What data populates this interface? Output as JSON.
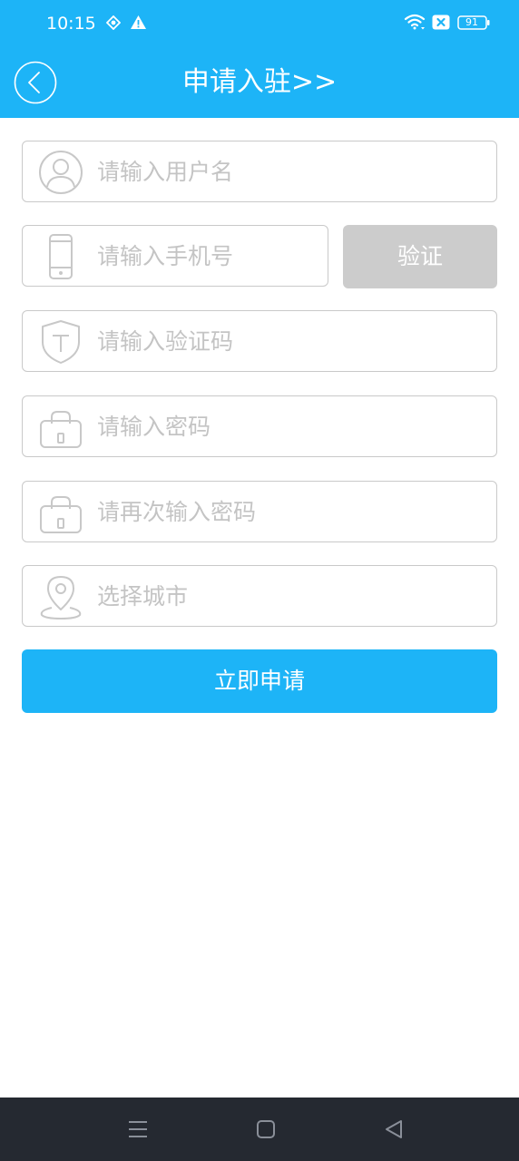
{
  "status_bar": {
    "time": "10:15",
    "battery": "91",
    "icons": [
      "location-icon",
      "alert-icon",
      "wifi-icon",
      "sim-off-icon",
      "battery-icon"
    ]
  },
  "header": {
    "title": "申请入驻>>",
    "back_icon": "chevron-left-icon"
  },
  "form": {
    "username": {
      "placeholder": "请输入用户名",
      "value": "",
      "icon": "user-icon"
    },
    "phone": {
      "placeholder": "请输入手机号",
      "value": "",
      "icon": "phone-icon"
    },
    "verify_button": "验证",
    "code": {
      "placeholder": "请输入验证码",
      "value": "",
      "icon": "shield-icon"
    },
    "password": {
      "placeholder": "请输入密码",
      "value": "",
      "icon": "lock-icon"
    },
    "password_confirm": {
      "placeholder": "请再次输入密码",
      "value": "",
      "icon": "lock-icon"
    },
    "city": {
      "placeholder": "选择城市",
      "value": "",
      "icon": "location-pin-icon"
    },
    "submit_button": "立即申请"
  },
  "nav_bar": {
    "buttons": [
      "menu-icon",
      "home-square-icon",
      "back-triangle-icon"
    ]
  },
  "colors": {
    "primary": "#1db4f7",
    "verify_disabled": "#cccccc",
    "border": "#c9c9c9",
    "placeholder": "#c4c4c4",
    "icon": "#c8c8c8",
    "nav_bar": "#252931"
  }
}
